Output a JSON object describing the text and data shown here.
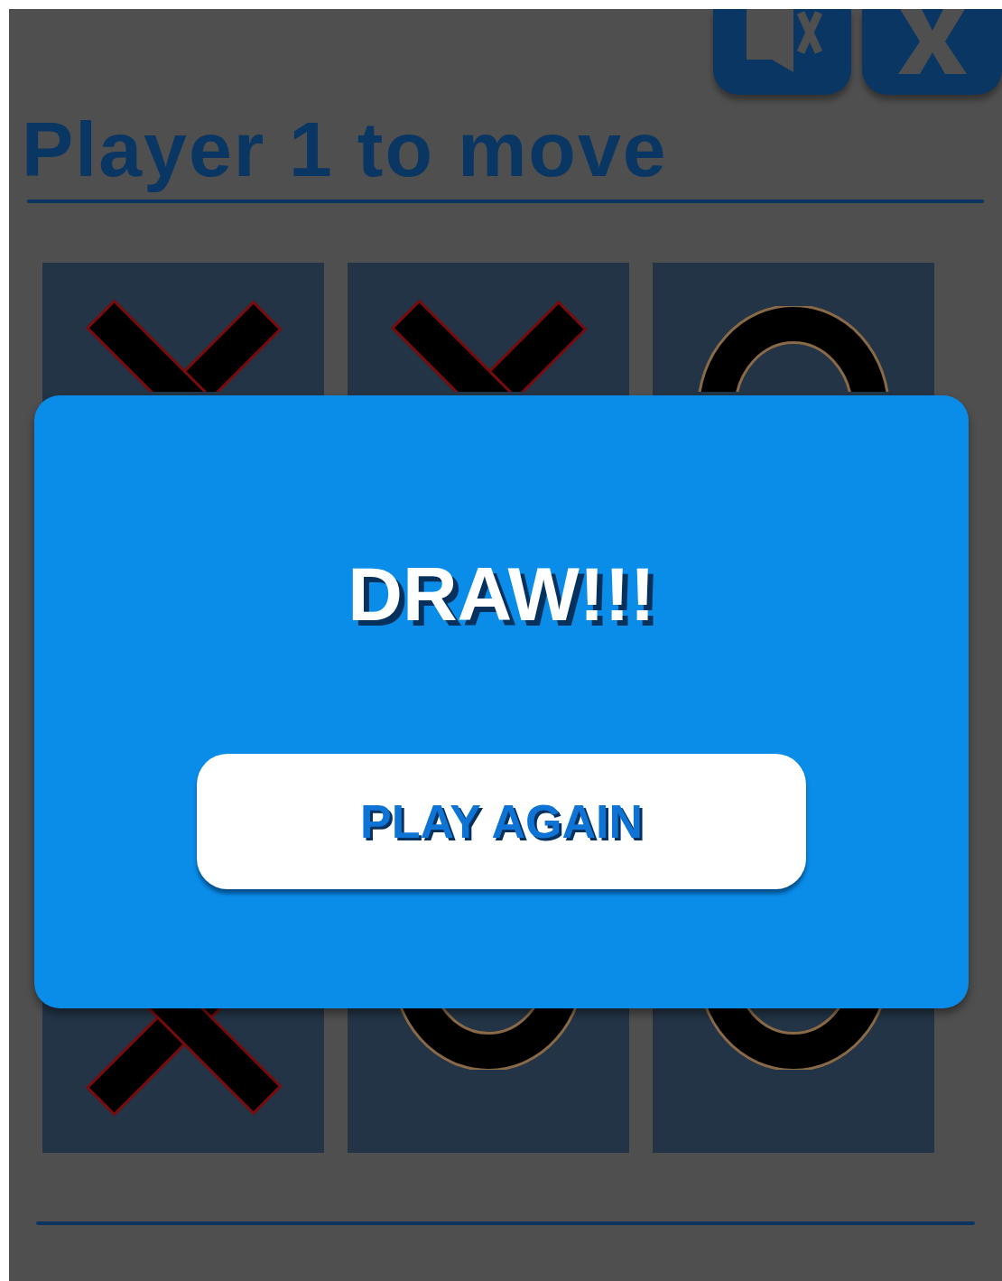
{
  "heading": "Player 1 to move",
  "board": {
    "top_row": [
      {
        "kind": "x"
      },
      {
        "kind": "x"
      },
      {
        "kind": "o"
      }
    ],
    "bottom_row": [
      {
        "kind": "x"
      },
      {
        "kind": "o"
      },
      {
        "kind": "o"
      }
    ]
  },
  "dialog": {
    "message": "DRAW!!!",
    "button": "PLAY AGAIN"
  }
}
